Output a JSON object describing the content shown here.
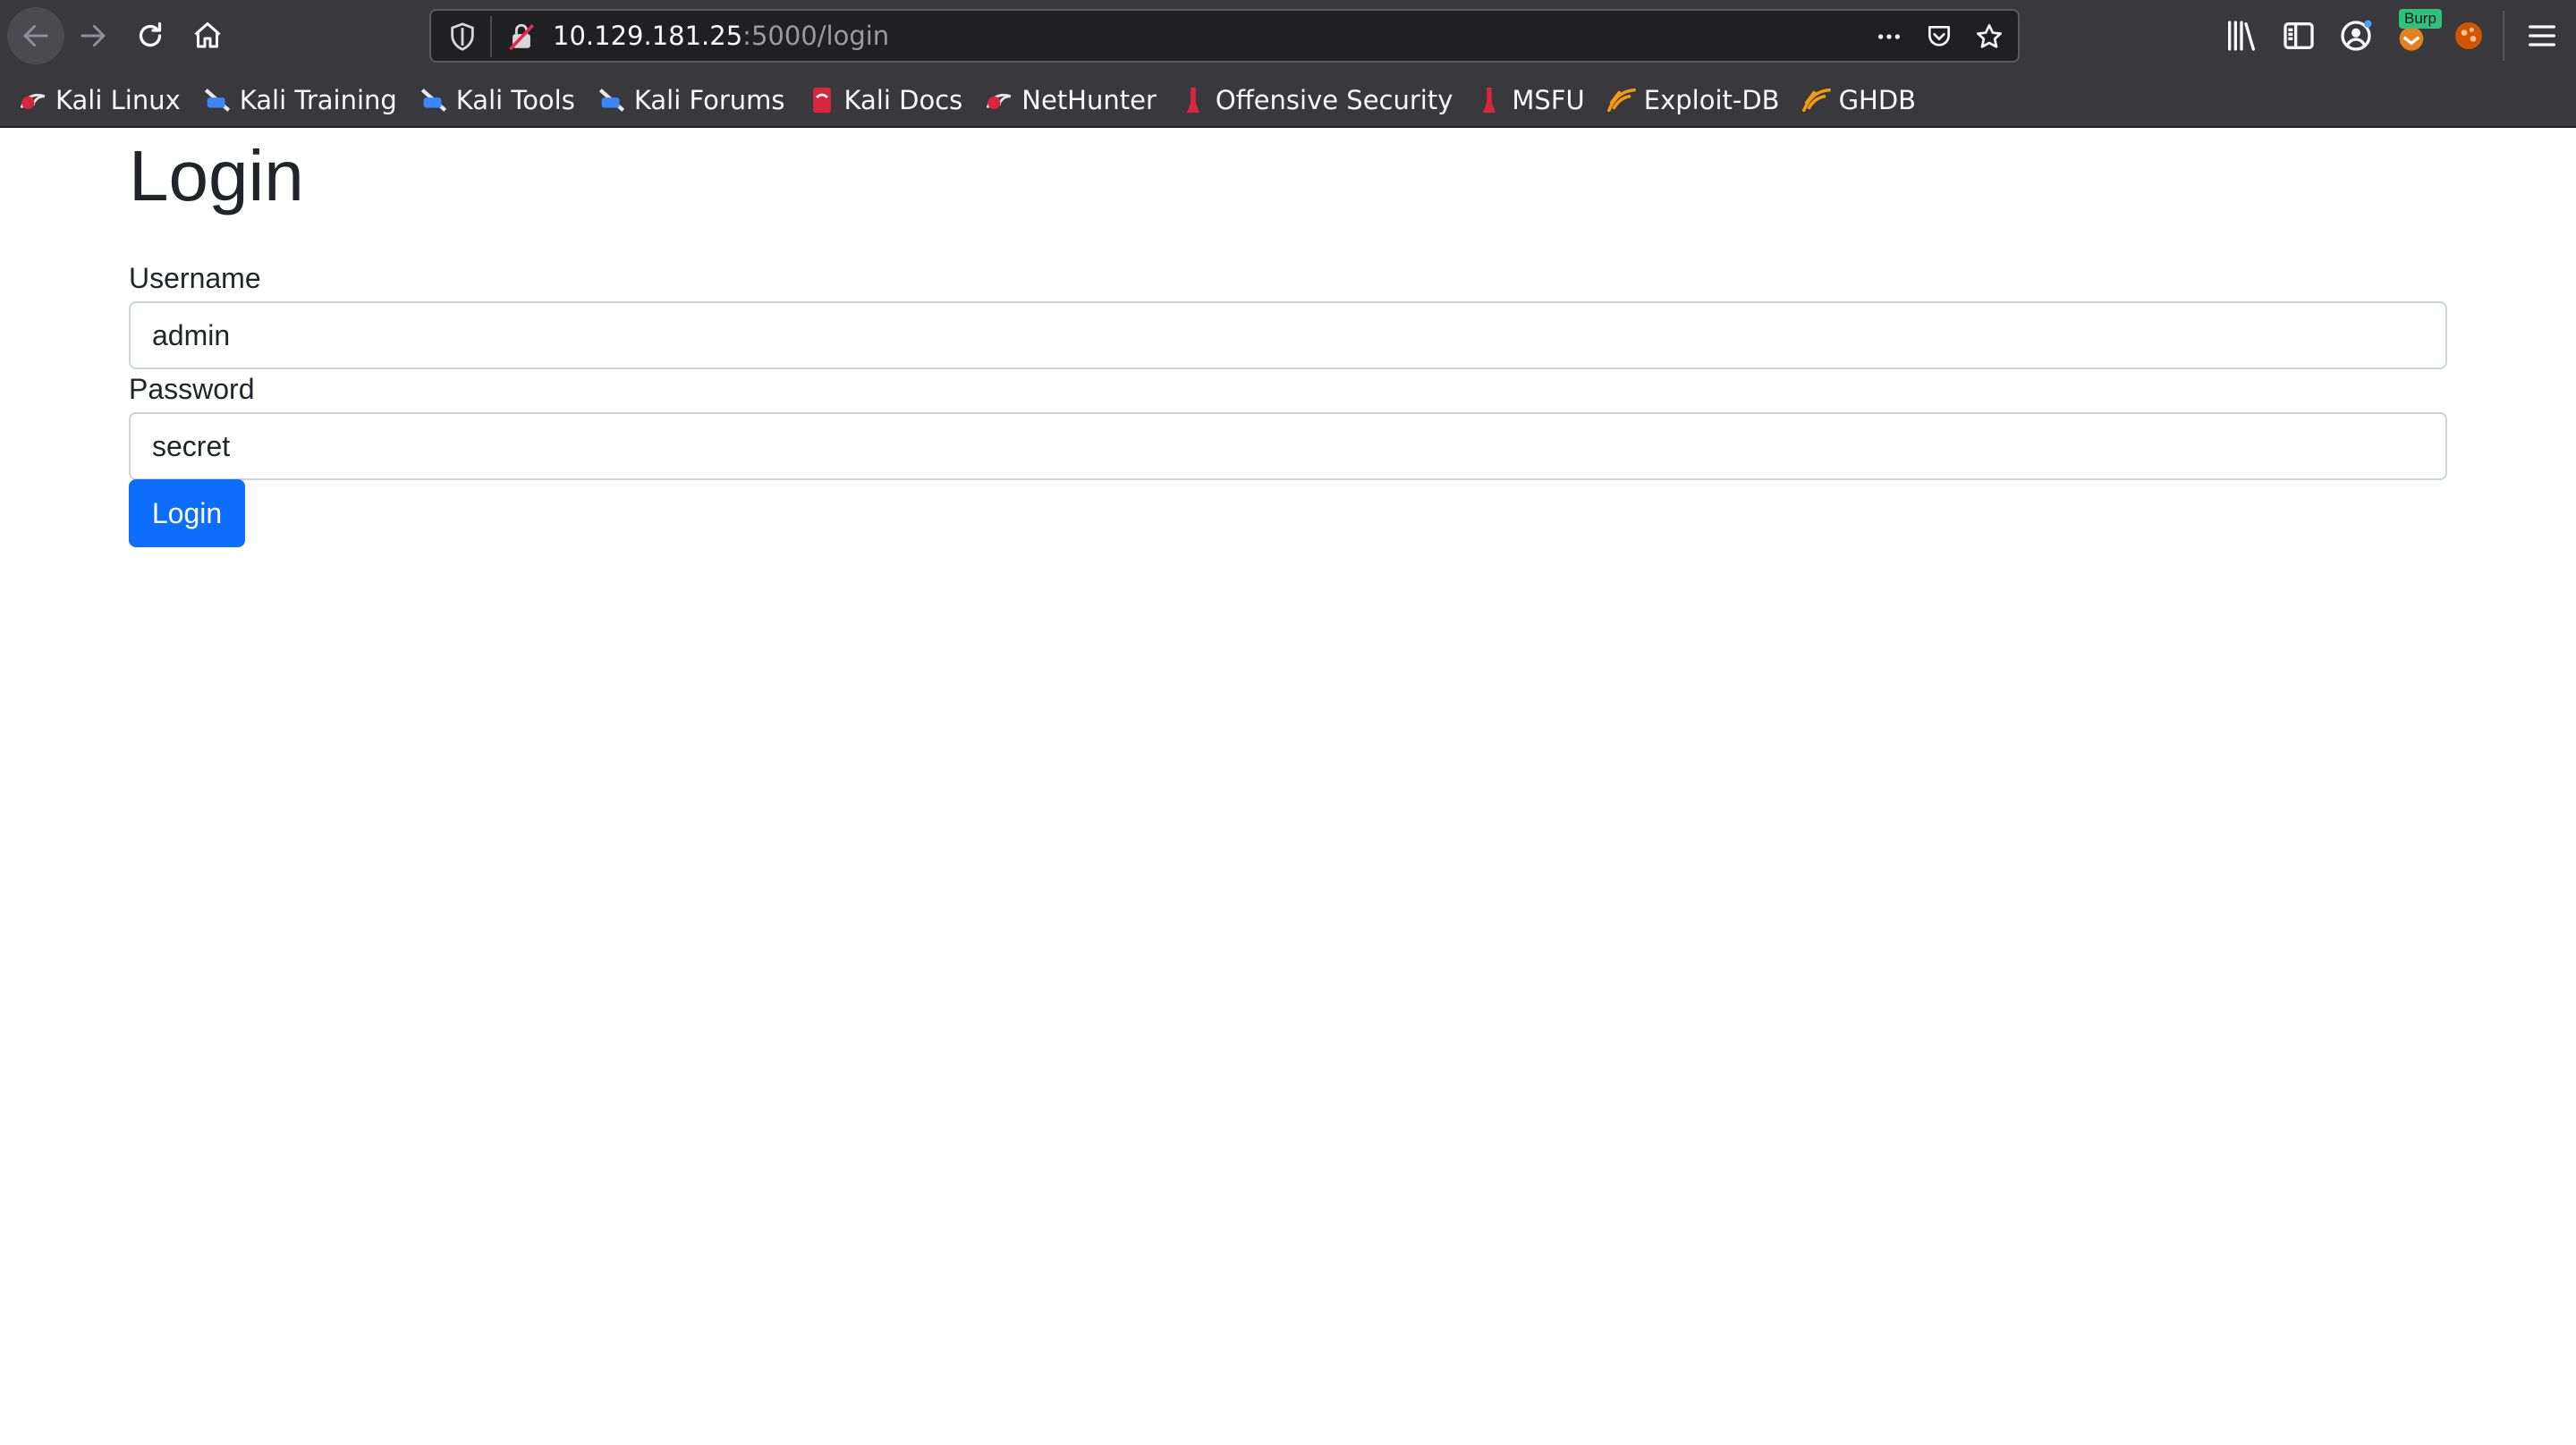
{
  "browser": {
    "url_host": "10.129.181.25",
    "url_rest": ":5000/login",
    "burp_badge": "Burp"
  },
  "bookmarks": [
    {
      "label": "Kali Linux",
      "icon": "kali-dragon-icon"
    },
    {
      "label": "Kali Training",
      "icon": "kali-training-icon"
    },
    {
      "label": "Kali Tools",
      "icon": "kali-tools-icon"
    },
    {
      "label": "Kali Forums",
      "icon": "kali-forums-icon"
    },
    {
      "label": "Kali Docs",
      "icon": "kali-docs-icon"
    },
    {
      "label": "NetHunter",
      "icon": "nethunter-icon"
    },
    {
      "label": "Offensive Security",
      "icon": "offsec-icon"
    },
    {
      "label": "MSFU",
      "icon": "msfu-icon"
    },
    {
      "label": "Exploit-DB",
      "icon": "exploitdb-icon"
    },
    {
      "label": "GHDB",
      "icon": "ghdb-icon"
    }
  ],
  "page": {
    "title": "Login",
    "username_label": "Username",
    "username_value": "admin",
    "password_label": "Password",
    "password_value": "secret",
    "submit_label": "Login"
  },
  "colors": {
    "chrome_bg": "#38383d",
    "primary": "#0d6efd",
    "text": "#212529"
  }
}
